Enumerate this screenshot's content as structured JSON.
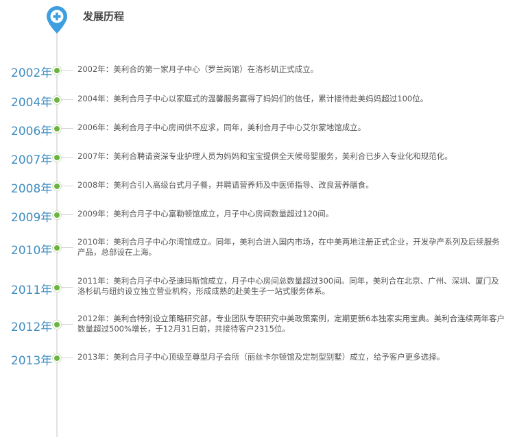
{
  "header": {
    "title": "发展历程",
    "icon": "plus-location-pin-icon"
  },
  "colors": {
    "year": "#3f8dc0",
    "dot": "#6cb33f",
    "pin": "#3d9fe0",
    "line": "#e2e2e2"
  },
  "timeline": [
    {
      "year": "2002年",
      "text": "2002年：美利合的第一家月子中心（罗兰岗馆）在洛杉矶正式成立。"
    },
    {
      "year": "2004年",
      "text": "2004年：美利合月子中心以家庭式的温馨服务赢得了妈妈们的信任，累计接待赴美妈妈超过100位。"
    },
    {
      "year": "2006年",
      "text": "2006年：美利合月子中心房间供不应求，同年，美利合月子中心艾尔蒙地馆成立。"
    },
    {
      "year": "2007年",
      "text": "2007年：美利合聘请资深专业护理人员为妈妈和宝宝提供全天候母婴服务，美利合已步入专业化和规范化。"
    },
    {
      "year": "2008年",
      "text": "2008年：美利合引入高级台式月子餐，并聘请营养师及中医师指导、改良营养膳食。"
    },
    {
      "year": "2009年",
      "text": "2009年：美利合月子中心富勒顿馆成立，月子中心房间数量超过120间。"
    },
    {
      "year": "2010年",
      "text": "2010年：美利合月子中心尔湾馆成立。同年，美利合进入国内市场，在中美两地注册正式企业，开发孕产系列及后续服务产品，总部设在上海。"
    },
    {
      "year": "2011年",
      "text": "2011年：美利合月子中心圣迪玛斯馆成立，月子中心房间总数量超过300间。同年，美利合在北京、广州、深圳、厦门及洛杉矶与纽约设立独立营业机构，形成成熟的赴美生子一站式服务体系。"
    },
    {
      "year": "2012年",
      "text": "2012年：美利合特别设立策略研究部，专业团队专职研究中美政策案例，定期更新6本独家实用宝典。美利合连续两年客户数量超过500%增长，于12月31日前，共接待客户2315位。"
    },
    {
      "year": "2013年",
      "text": "2013年：美利合月子中心顶级至尊型月子会所（丽丝卡尔顿馆及定制型别墅）成立，给予客户更多选择。"
    }
  ]
}
